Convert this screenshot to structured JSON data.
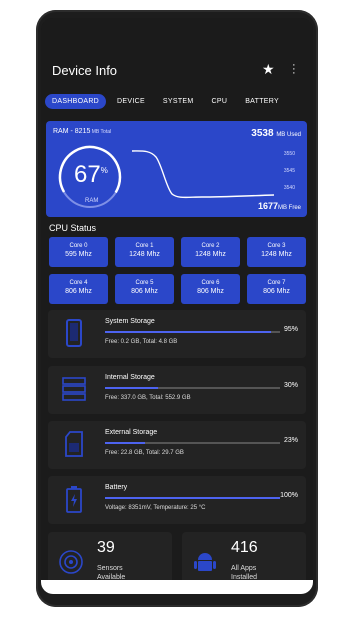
{
  "app": {
    "title": "Device Info"
  },
  "tabs": [
    {
      "label": "DASHBOARD",
      "active": true
    },
    {
      "label": "DEVICE",
      "active": false
    },
    {
      "label": "SYSTEM",
      "active": false
    },
    {
      "label": "CPU",
      "active": false
    },
    {
      "label": "BATTERY",
      "active": false
    }
  ],
  "ram": {
    "label": "RAM - ",
    "total": "8215",
    "total_unit": " MB Total",
    "used": "3538",
    "used_unit": "MB Used",
    "free": "1677",
    "free_unit": "MB Free",
    "percent": "67",
    "percent_sign": "%",
    "gauge_label": "RAM",
    "axis_labels": [
      "3550",
      "3545",
      "3540"
    ]
  },
  "cpu": {
    "title": "CPU Status",
    "cores": [
      {
        "name": "Core 0",
        "freq": "595 Mhz"
      },
      {
        "name": "Core 1",
        "freq": "1248 Mhz"
      },
      {
        "name": "Core 2",
        "freq": "1248 Mhz"
      },
      {
        "name": "Core 3",
        "freq": "1248 Mhz"
      },
      {
        "name": "Core 4",
        "freq": "806 Mhz"
      },
      {
        "name": "Core 5",
        "freq": "806 Mhz"
      },
      {
        "name": "Core 6",
        "freq": "806 Mhz"
      },
      {
        "name": "Core 7",
        "freq": "806 Mhz"
      }
    ]
  },
  "storage": [
    {
      "label": "System Storage",
      "percent": "95%",
      "fill": 0.95,
      "info": "Free: 0.2 GB,  Total: 4.8 GB"
    },
    {
      "label": "Internal Storage",
      "percent": "30%",
      "fill": 0.3,
      "info": "Free: 337.0 GB,  Total: 552.9 GB"
    },
    {
      "label": "External Storage",
      "percent": "23%",
      "fill": 0.23,
      "info": "Free: 22.8 GB,  Total: 29.7 GB"
    },
    {
      "label": "Battery",
      "percent": "100%",
      "fill": 1.0,
      "info": "Voltage: 8351mV,  Temperature: 25 °C"
    }
  ],
  "sensors": {
    "count": "39",
    "label_line1": "Sensors",
    "label_line2": "Available"
  },
  "apps": {
    "count": "416",
    "label_line1": "All Apps",
    "label_line2": "Installed"
  },
  "colors": {
    "accent": "#2b47c9",
    "background": "#1b1b1b",
    "card": "#232323",
    "bar": "#4d63f0"
  }
}
